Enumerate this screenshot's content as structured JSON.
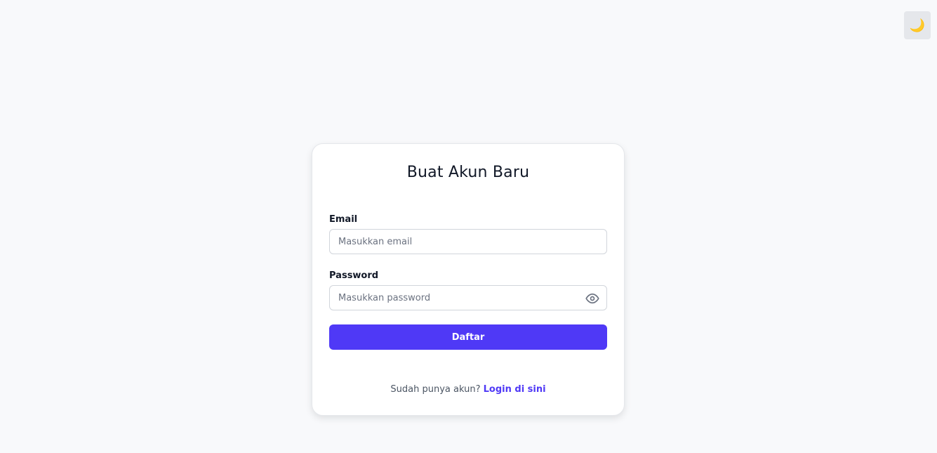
{
  "theme_toggle": {
    "icon": "moon-icon",
    "glyph": "🌙"
  },
  "form": {
    "title": "Buat Akun Baru",
    "email": {
      "label": "Email",
      "placeholder": "Masukkan email",
      "value": ""
    },
    "password": {
      "label": "Password",
      "placeholder": "Masukkan password",
      "value": "",
      "toggle_icon": "eye-icon"
    },
    "submit_label": "Daftar",
    "footer_text": "Sudah punya akun?",
    "login_link": "Login di sini"
  },
  "colors": {
    "accent": "#4f39f6",
    "background": "#f8f9fb",
    "card": "#ffffff",
    "toggle_bg": "#e5e7eb"
  }
}
